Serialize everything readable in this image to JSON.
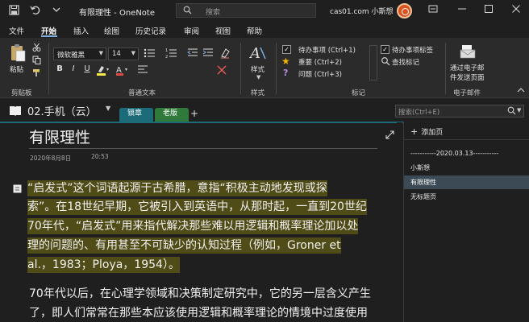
{
  "window": {
    "title": "有限理性 - OneNote",
    "search_placeholder": "搜索",
    "account": "cas01.com 小斯想"
  },
  "menu": {
    "tabs": [
      "文件",
      "开始",
      "插入",
      "绘图",
      "历史记录",
      "审阅",
      "视图",
      "帮助"
    ],
    "active": "开始"
  },
  "ribbon": {
    "paste_label": "粘贴",
    "clipboard_label": "剪贴板",
    "font_name": "微软雅黑",
    "font_size": "14",
    "basic_text_label": "普通文本",
    "styles_label": "样式",
    "styles_group_label": "样式",
    "tags": [
      "待办事项 (Ctrl+1)",
      "重要 (Ctrl+2)",
      "问题 (Ctrl+3)"
    ],
    "todo_tag_label": "待办事项标签",
    "find_tags_label": "查找标记",
    "tags_group_label": "标记",
    "email_line1": "通过电子邮",
    "email_line2": "件发送页面",
    "email_group_label": "电子邮件"
  },
  "notebook": {
    "name": "02.手机（云）",
    "sections": [
      {
        "label": "锁章",
        "color": "#1b6b78"
      },
      {
        "label": "老版",
        "color": "#2f7a3a"
      }
    ],
    "add_section": "+",
    "page_search_placeholder": "搜索(Ctrl+E)"
  },
  "note": {
    "title": "有限理性",
    "date": "2020年8月8日",
    "time": "20:53",
    "paragraph1_lines": [
      "“启发式”这个词语起源于古希腊，意指“积极主动地发现或探",
      "索”。在18世纪早期，它被引入到英语中，从那时起，一直到20世纪",
      "70年代，“启发式”用来指代解决那些难以用逻辑和概率理论加以处",
      "理的问题的、有用甚至不可缺少的认知过程（例如，Groner et",
      "al.，1983；Ploya，1954）。"
    ],
    "paragraph2_lines": [
      "70年代以后，在心理学领域和决策制定研究中，它的另一层含义产生",
      "了，即人们常常在那些本应该使用逻辑和概率理论的情境中过度使用"
    ]
  },
  "pages": {
    "add_label": "添加页",
    "items": [
      {
        "label": "-----------2020.03.13-----------",
        "selected": false
      },
      {
        "label": "小斯想",
        "selected": false
      },
      {
        "label": "有限理性",
        "selected": true
      },
      {
        "label": "无标题页",
        "selected": false
      }
    ]
  },
  "colors": {
    "accent": "#7fb1e6",
    "highlight": "#504c17",
    "section_teal": "#1b6b78",
    "section_green": "#2f7a3a",
    "selected_page": "#3b4a55"
  }
}
